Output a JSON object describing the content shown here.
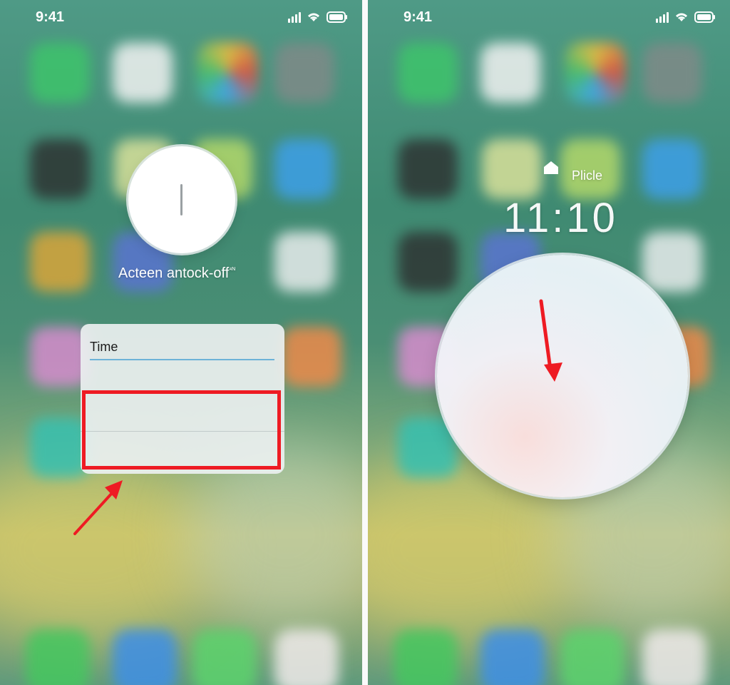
{
  "left_screen": {
    "status": {
      "time": "9:41"
    },
    "dial_caption": "Acteen antock-off",
    "dial_caption_superscript": "⁴ᴺ",
    "time_card": {
      "label": "Time"
    },
    "annotation_color": "#ee1b23"
  },
  "right_screen": {
    "status": {
      "time": "9:41"
    },
    "place_label": "Plicle",
    "clock_text": "11:10",
    "annotation_color": "#ee1b23"
  }
}
